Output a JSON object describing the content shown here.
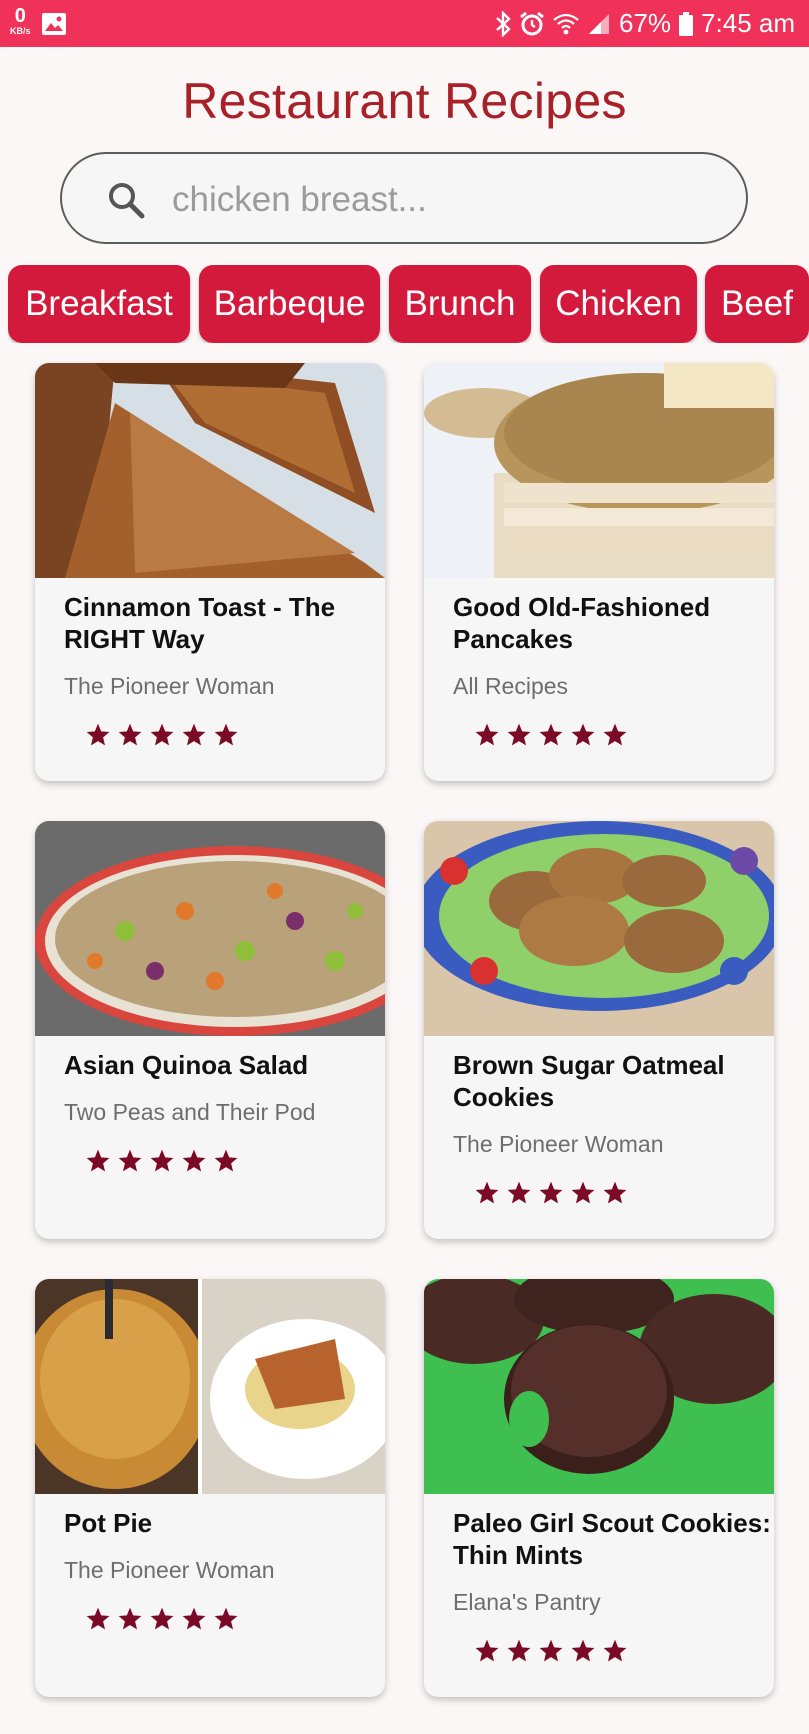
{
  "status_bar": {
    "net_speed_value": "0",
    "net_speed_unit": "KB/s",
    "battery": "67%",
    "time": "7:45 am"
  },
  "header": {
    "title": "Restaurant Recipes",
    "search_placeholder": "chicken breast..."
  },
  "categories": [
    "Breakfast",
    "Barbeque",
    "Brunch",
    "Chicken",
    "Beef"
  ],
  "colors": {
    "status_bar": "#f0325a",
    "title": "#a82128",
    "chip": "#d41a3c",
    "star": "#7a0a25"
  },
  "recipes": [
    {
      "title": "Cinnamon Toast - The RIGHT Way",
      "source": "The Pioneer Woman",
      "rating": 5,
      "image": "cinnamon-toast-photo"
    },
    {
      "title": "Good Old-Fashioned Pancakes",
      "source": "All Recipes",
      "rating": 5,
      "image": "pancakes-photo"
    },
    {
      "title": "Asian Quinoa Salad",
      "source": "Two Peas and Their Pod",
      "rating": 5,
      "image": "quinoa-salad-photo"
    },
    {
      "title": "Brown Sugar Oatmeal Cookies",
      "source": "The Pioneer Woman",
      "rating": 5,
      "image": "oatmeal-cookies-photo"
    },
    {
      "title": "Pot Pie",
      "source": "The Pioneer Woman",
      "rating": 5,
      "image": "pot-pie-photo"
    },
    {
      "title": "Paleo Girl Scout Cookies: Thin Mints",
      "source": "Elana's Pantry",
      "rating": 5,
      "image": "thin-mints-photo"
    }
  ]
}
